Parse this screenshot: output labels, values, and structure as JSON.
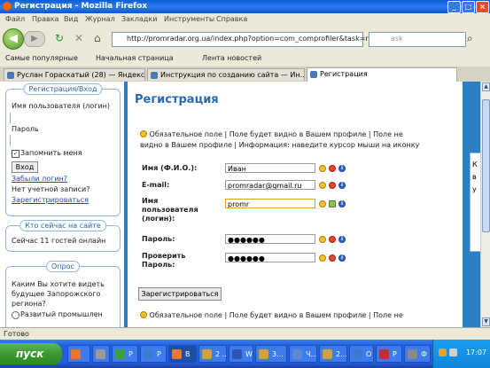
{
  "window": {
    "title": "Регистрация - Mozilla Firefox"
  },
  "menu": [
    "Файл",
    "Правка",
    "Вид",
    "Журнал",
    "Закладки",
    "Инструменты",
    "Справка"
  ],
  "nav": {
    "url": "http://promradar.org.ua/index.php?option=com_comprofiler&task=registers",
    "search_placeholder": "ask"
  },
  "bookmarks": [
    "Самые популярные",
    "Начальная страница",
    "Лента новостей"
  ],
  "tabs": [
    "Руслан Гораскатый (28) — Яндекс.П...",
    "Инструкция по созданию сайта — Ин...",
    "Регистрация"
  ],
  "sidebar": {
    "login_header": "Регистрация/Вход",
    "username_label": "Имя пользователя (логин)",
    "password_label": "Пароль",
    "remember_label": "Запомнить меня",
    "login_button": "Вход",
    "forgot_link": "Забыли логин?",
    "no_account": "Нет учетной записи?",
    "register_link": "Зарегистрироваться",
    "online_header": "Кто сейчас на сайте",
    "online_text": "Сейчас 11 гостей онлайн",
    "poll_header": "Опрос",
    "poll_question": "Каким Вы хотите видеть будущее Запорожского региона?",
    "poll_option": "Развитый промышлен"
  },
  "main": {
    "title": "Регистрация",
    "legend_line1": "Обязательное поле | Поле будет видно в Вашем профиле | Поле не",
    "legend_line2": "видно в Вашем профиле | Информация: наведите курсор мыши на иконку",
    "fields": [
      {
        "label": "Имя (Ф.И.О.):",
        "value": "Иван"
      },
      {
        "label": "E-mail:",
        "value": "promradar@gmail.ru"
      },
      {
        "label": "Имя пользователя (логин):",
        "value": "promr"
      },
      {
        "label": "Пароль:",
        "value": "●●●●●●"
      },
      {
        "label": "Проверить Пароль:",
        "value": "●●●●●●"
      }
    ],
    "register_button": "Зарегистрироваться",
    "legend_bottom": "Обязательное поле | Поле будет видно в Вашем профиле | Поле не"
  },
  "right_panel": {
    "letters": "К в у"
  },
  "status": {
    "text": "Готово"
  },
  "taskbar": {
    "start": "пуск",
    "buttons": [
      "Р",
      "Р",
      "В",
      "2 ...",
      "W",
      "3...",
      "Ч...",
      "2...",
      "О",
      "Р",
      "Ф"
    ],
    "clock": "17:07"
  },
  "colors": {
    "title_blue": "#2b6cb0",
    "page_bg": "#2d7fc3",
    "start_green": "#3a9a2e"
  }
}
